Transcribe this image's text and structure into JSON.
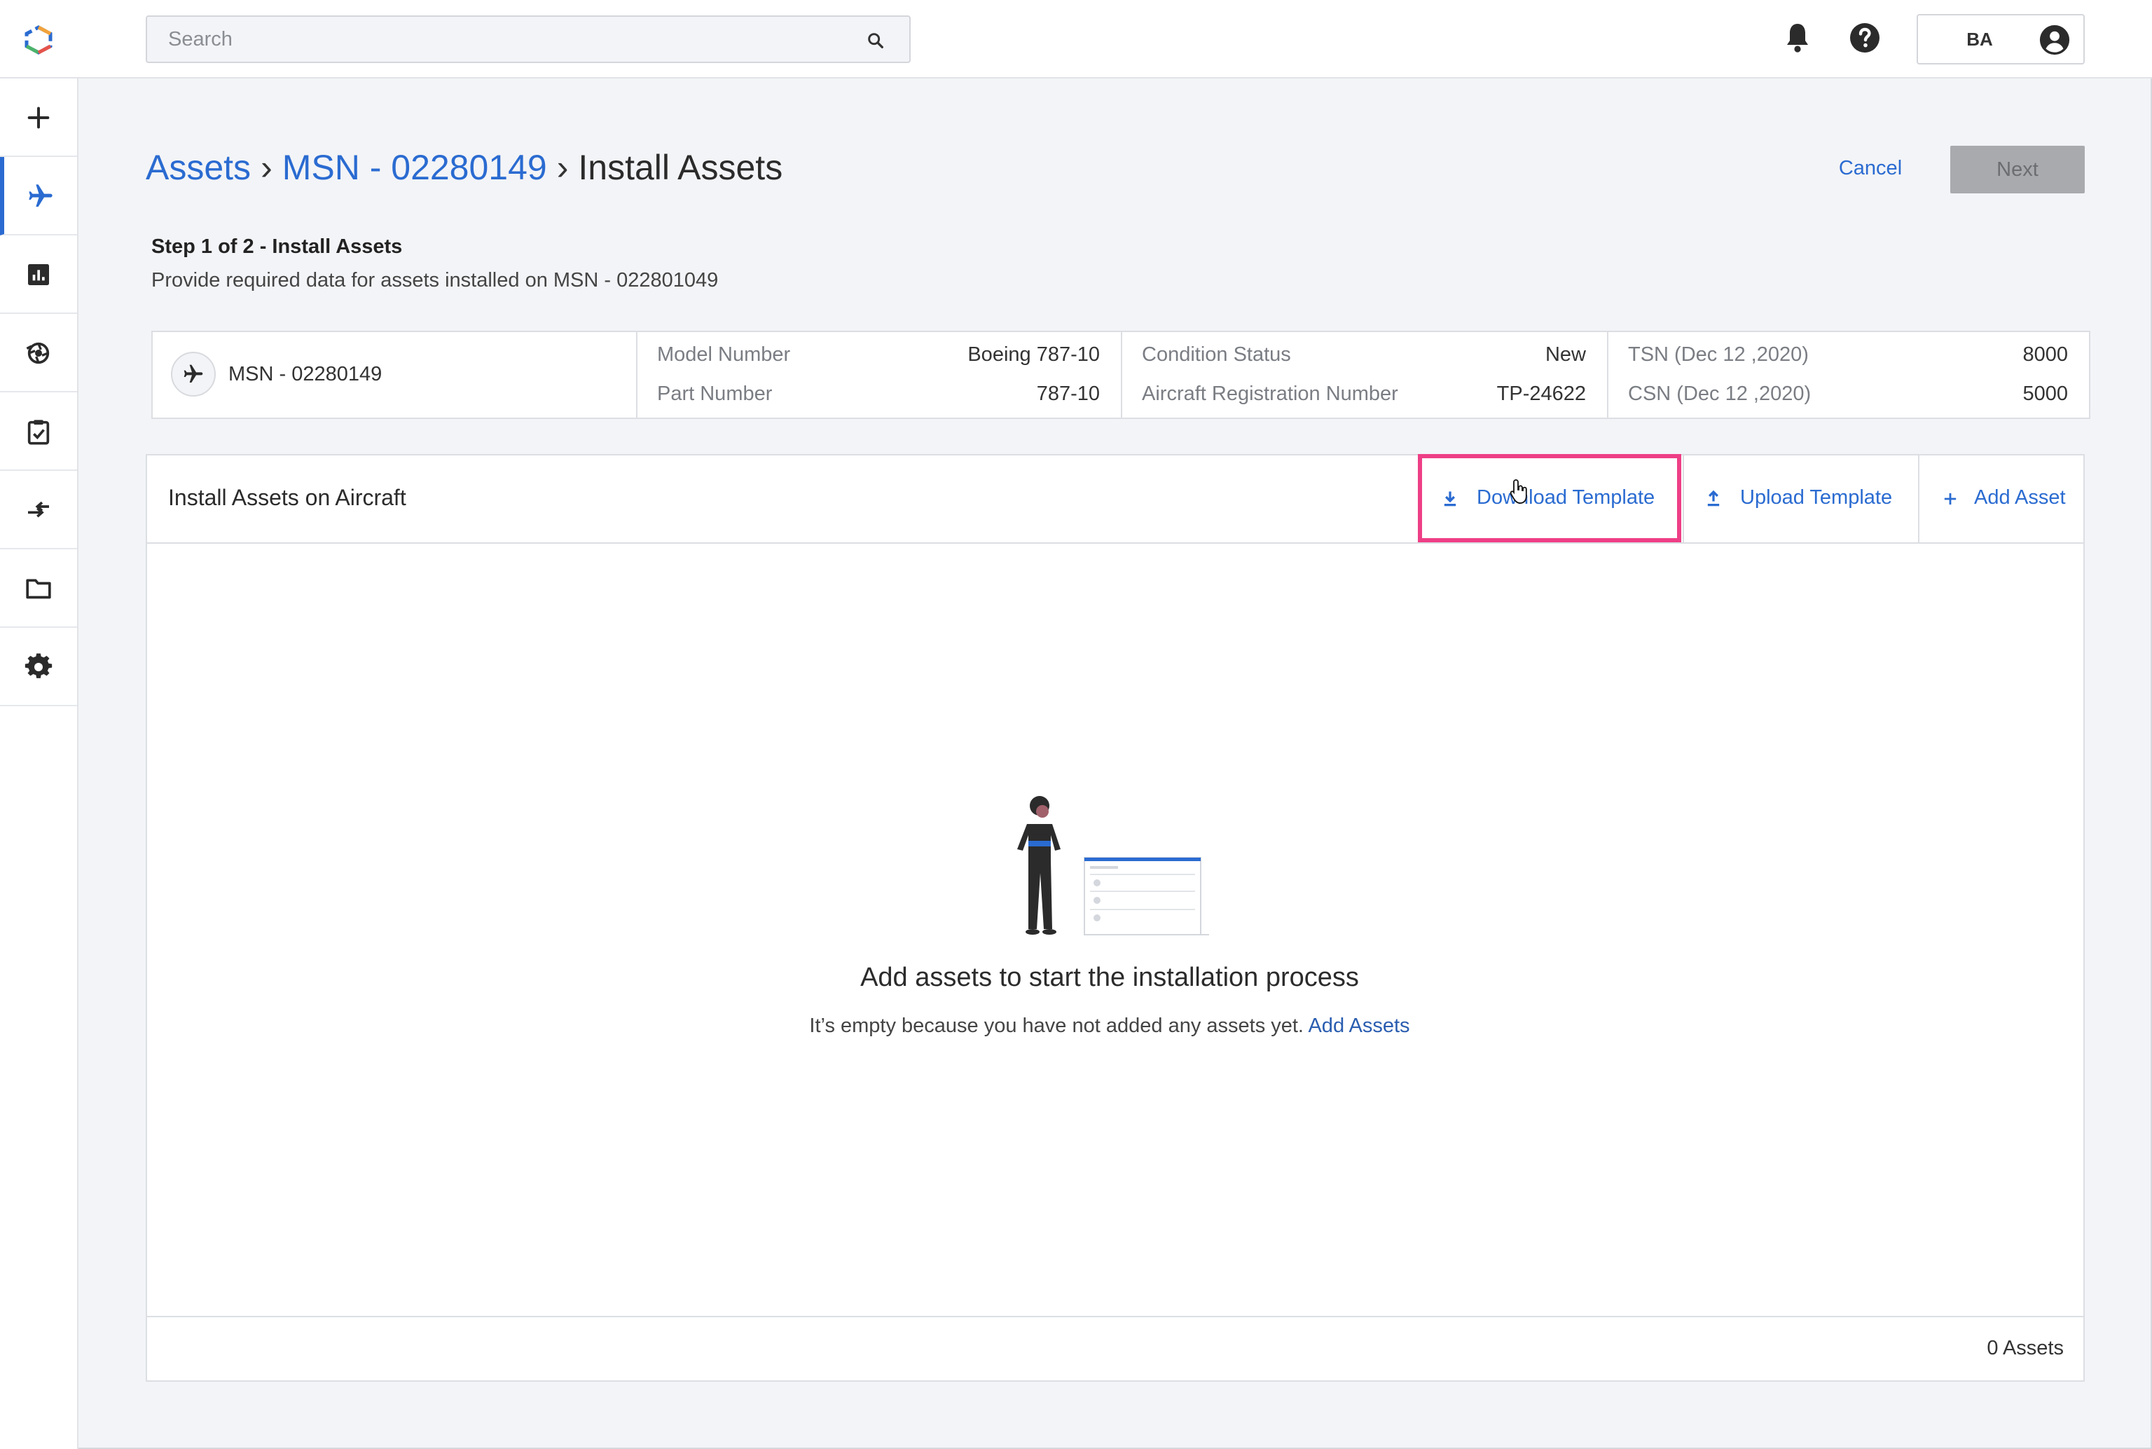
{
  "search": {
    "placeholder": "Search"
  },
  "user": {
    "initials": "BA"
  },
  "breadcrumb": {
    "root": "Assets",
    "parent": "MSN - 02280149",
    "current": "Install Assets",
    "separator": "›"
  },
  "actions": {
    "cancel": "Cancel",
    "next": "Next"
  },
  "step": {
    "title": "Step 1 of 2 - Install Assets",
    "description": "Provide required data for assets installed on MSN - 022801049"
  },
  "aircraft": {
    "msn": "MSN - 02280149",
    "model_number_label": "Model Number",
    "model_number": "Boeing 787-10",
    "part_number_label": "Part Number",
    "part_number": "787-10",
    "condition_status_label": "Condition Status",
    "condition_status": "New",
    "registration_label": "Aircraft Registration Number",
    "registration": "TP-24622",
    "tsn_label": "TSN (Dec 12 ,2020)",
    "tsn": "8000",
    "csn_label": "CSN (Dec 12 ,2020)",
    "csn": "5000"
  },
  "panel": {
    "title": "Install Assets on Aircraft",
    "download_template": "Download Template",
    "upload_template": "Upload Template",
    "add_asset": "Add Asset"
  },
  "empty_state": {
    "title": "Add assets to start the installation process",
    "description": "It’s empty because you have not added any assets yet.",
    "link": "Add Assets"
  },
  "footer": {
    "count": "0 Assets"
  },
  "colors": {
    "accent": "#2a6bd1",
    "highlight": "#ee3f86",
    "disabled": "#a8aaae"
  },
  "icons": {
    "topbar": [
      "app-logo",
      "search-icon",
      "bell-icon",
      "help-icon",
      "account-icon"
    ],
    "sidebar": [
      "plus-icon",
      "airplane-icon",
      "bar-chart-icon",
      "engine-icon",
      "clipboard-check-icon",
      "transfer-arrows-icon",
      "folder-icon",
      "gear-icon"
    ]
  }
}
